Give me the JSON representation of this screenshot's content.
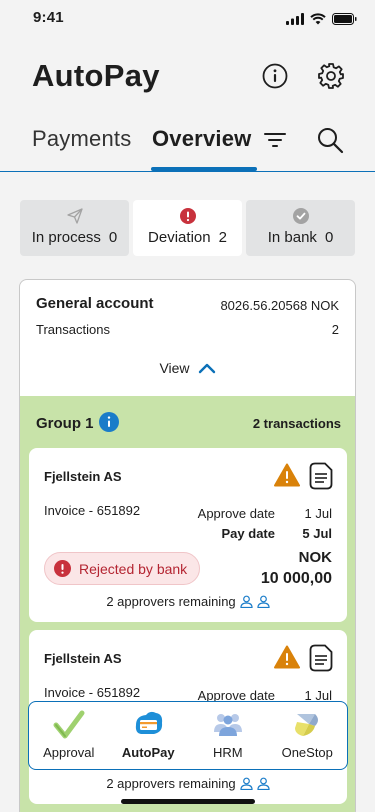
{
  "status_bar": {
    "time": "9:41"
  },
  "app": {
    "title": "AutoPay"
  },
  "tabs": {
    "payments": "Payments",
    "overview": "Overview"
  },
  "segments": [
    {
      "label": "In process",
      "count": "0",
      "icon": "send-icon"
    },
    {
      "label": "Deviation",
      "count": "2",
      "icon": "alert-circle-icon",
      "active": true
    },
    {
      "label": "In bank",
      "count": "0",
      "icon": "check-circle-icon"
    }
  ],
  "account": {
    "name": "General account",
    "number": "8026.56.20568 NOK",
    "transactions_label": "Transactions",
    "transactions_count": "2",
    "view_label": "View"
  },
  "group": {
    "title": "Group 1",
    "count_label": "2 transactions",
    "transactions": [
      {
        "company": "Fjellstein AS",
        "invoice": "Invoice - 651892",
        "approve_label": "Approve date",
        "approve_date": "1 Jul",
        "pay_label": "Pay date",
        "pay_date": "5 Jul",
        "status": "Rejected by bank",
        "currency": "NOK",
        "amount": "10 000,00",
        "approvers": "2 approvers remaining"
      },
      {
        "company": "Fjellstein AS",
        "invoice": "Invoice - 651892",
        "approve_label": "Approve date",
        "approve_date": "1 Jul",
        "approvers": "2 approvers remaining"
      }
    ]
  },
  "bottom_nav": [
    {
      "label": "Approval",
      "icon": "approval-check-icon"
    },
    {
      "label": "AutoPay",
      "icon": "autopay-icon",
      "active": true
    },
    {
      "label": "HRM",
      "icon": "hrm-people-icon"
    },
    {
      "label": "OneStop",
      "icon": "onestop-icon"
    }
  ],
  "colors": {
    "accent": "#0b70b8",
    "group_bg": "#c8e3a9",
    "warning": "#d9820a",
    "error": "#c8323d"
  }
}
